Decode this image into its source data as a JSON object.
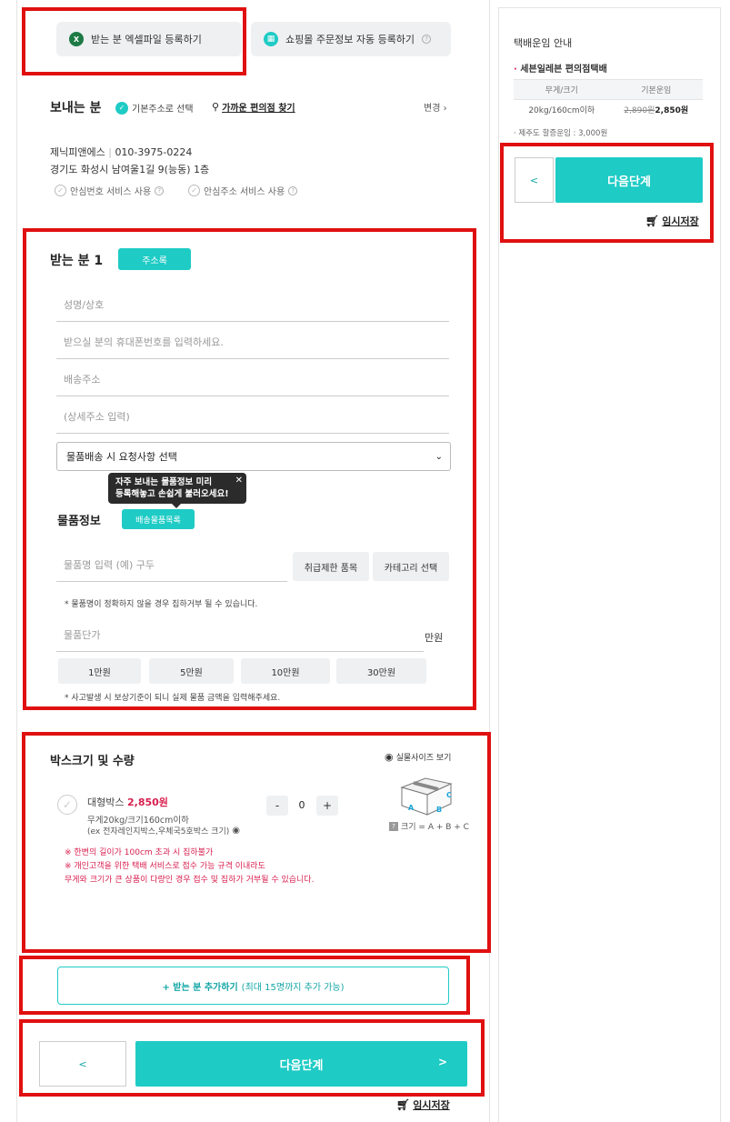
{
  "top": {
    "excel_btn": "받는 분 엑셀파일 등록하기",
    "shop_btn": "쇼핑몰 주문정보 자동 등록하기"
  },
  "sender": {
    "title": "보내는 분",
    "default_addr": "기본주소로 선택",
    "nearby": "가까운 편의점 찾기",
    "change": "변경",
    "name": "제닉피앤에스",
    "phone": "010-3975-0224",
    "address": "경기도 화성시 남여울1길 9(능동) 1층",
    "safe_number": "안심번호 서비스 사용",
    "safe_address": "안심주소 서비스 사용"
  },
  "receiver": {
    "title": "받는 분 1",
    "addressbook": "주소록",
    "name_placeholder": "성명/상호",
    "phone_placeholder": "받으실 분의 휴대폰번호를 입력하세요.",
    "addr_placeholder": "배송주소",
    "addr_detail_placeholder": "(상세주소 입력)",
    "request_select": "물품배송 시 요청사항 선택"
  },
  "tooltip": {
    "line1": "자주 보내는 물품정보 미리",
    "line2": "등록해놓고 손쉽게 불러오세요!",
    "close": "✕"
  },
  "item": {
    "title": "물품정보",
    "list_btn": "배송물품목록",
    "name_placeholder": "물품명 입력 (예) 구두",
    "restricted_btn": "취급제한 품목",
    "category_btn": "카테고리 선택",
    "name_note": "* 물품명이 정확하지 않을 경우 집하거부 될 수 있습니다.",
    "price_placeholder": "물품단가",
    "price_unit": "만원",
    "price_options": [
      "1만원",
      "5만원",
      "10만원",
      "30만원"
    ],
    "price_note": "* 사고발생 시 보상기준이 되니 실제 물품 금액을 입력해주세요."
  },
  "box": {
    "title": "박스크기 및 수량",
    "real_size": "실물사이즈 보기",
    "name": "대형박스",
    "price": "2,850원",
    "spec": "무게20kg/크기160cm이하",
    "example": "(ex 전자레인지박스,우체국5호박스 크기)",
    "minus": "-",
    "qty": "0",
    "plus": "+",
    "size_formula": "크기 = A + B + C",
    "label_a": "A",
    "label_b": "B",
    "label_c": "C",
    "warn1": "※ 한변의 길이가 100cm 초과 시 집하불가",
    "warn2": "※ 개인고객을 위한 택배 서비스로 접수 가능 규격 이내라도",
    "warn3": "무게와 크기가 큰 상품이 다량인 경우 접수 및 집하가 거부될 수 있습니다."
  },
  "add_receiver": {
    "label": "+ 받는 분 추가하기",
    "sub": "(최대 15명까지 추가 가능)"
  },
  "bottom_nav": {
    "prev": "<",
    "next": "다음단계",
    "next_arrow": ">",
    "temp_save": "임시저장"
  },
  "side": {
    "title": "택배운임 안내",
    "carrier": "세븐일레븐 편의점택배",
    "col1": "무게/크기",
    "col2": "기본운임",
    "row_size": "20kg/160cm이하",
    "old_price": "2,890원",
    "new_price": "2,850원",
    "jeju": "· 제주도 할증운임 : 3,000원",
    "prev": "<",
    "next": "다음단계",
    "temp_save": "임시저장"
  },
  "colors": {
    "accent": "#1fcbc5",
    "highlight": "#e01010",
    "warning": "#d81f4f"
  }
}
